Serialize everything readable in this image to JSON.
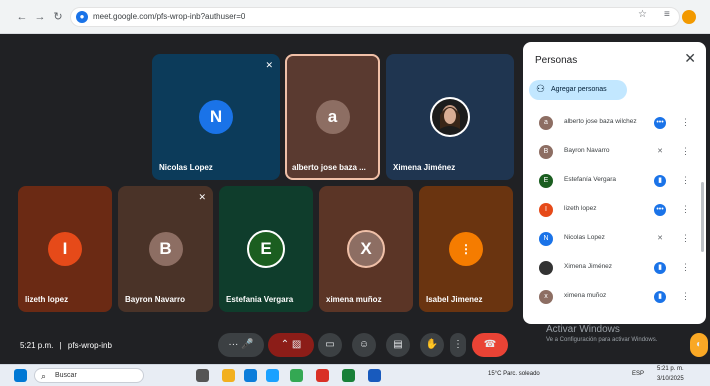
{
  "browser": {
    "url": "meet.google.com/pfs-wrop-inb?authuser=0",
    "back_icon": "arrow-left-icon",
    "forward_icon": "arrow-right-icon",
    "reload_icon": "reload-icon"
  },
  "tiles": [
    {
      "name": "Nicolas Lopez",
      "initial": "N",
      "bg": "#0c3b5a",
      "avatar": "#1a73e8",
      "muted": true
    },
    {
      "name": "alberto jose baza ...",
      "initial": "a",
      "bg": "#5a3a30",
      "avatar": "#8d6e63",
      "muted": false
    },
    {
      "name": "Ximena Jiménez",
      "initial": "",
      "bg": "#1f3550",
      "avatar": "#ffffff",
      "muted": false
    },
    {
      "name": "lizeth lopez",
      "initial": "I",
      "bg": "#6b2a14",
      "avatar": "#e64a19",
      "muted": false
    },
    {
      "name": "Bayron Navarro",
      "initial": "B",
      "bg": "#4a3328",
      "avatar": "#8d6e63",
      "muted": true
    },
    {
      "name": "Estefania Vergara",
      "initial": "E",
      "bg": "#0f3d2c",
      "avatar": "#1b5e20",
      "muted": false
    },
    {
      "name": "ximena muñoz",
      "initial": "X",
      "bg": "#5b3526",
      "avatar": "#8d6e63",
      "muted": false
    },
    {
      "name": "Isabel Jimenez",
      "initial": "",
      "bg": "#6a3410",
      "avatar": "#e65100",
      "muted": false
    }
  ],
  "panel": {
    "title": "Personas",
    "add_label": "Agregar personas",
    "people": [
      {
        "name": "alberto jose baza wilchez",
        "initial": "a",
        "color": "#8d6e63",
        "status": "more"
      },
      {
        "name": "Bayron Navarro",
        "initial": "B",
        "color": "#8d6e63",
        "status": "muted"
      },
      {
        "name": "Estefanía Vergara",
        "initial": "E",
        "color": "#1b5e20",
        "status": "speaking"
      },
      {
        "name": "lizeth lopez",
        "initial": "I",
        "color": "#e64a19",
        "status": "more"
      },
      {
        "name": "Nicolas Lopez",
        "initial": "N",
        "color": "#1a73e8",
        "status": "muted"
      },
      {
        "name": "Ximena Jiménez",
        "initial": "",
        "color": "#333333",
        "status": "speaking"
      },
      {
        "name": "ximena muñoz",
        "initial": "x",
        "color": "#8d6e63",
        "status": "speaking"
      }
    ]
  },
  "meeting": {
    "time": "5:21 p.m.",
    "separator": "|",
    "code": "pfs-wrop-inb"
  },
  "watermark": {
    "line1": "Activar Windows",
    "line2": "Ve a Configuración para activar Windows."
  },
  "taskbar": {
    "search_placeholder": "Buscar",
    "weather": "15°C Parc. soleado",
    "language": "ESP",
    "clock_time": "5:21 p. m.",
    "clock_date": "3/10/2025"
  }
}
